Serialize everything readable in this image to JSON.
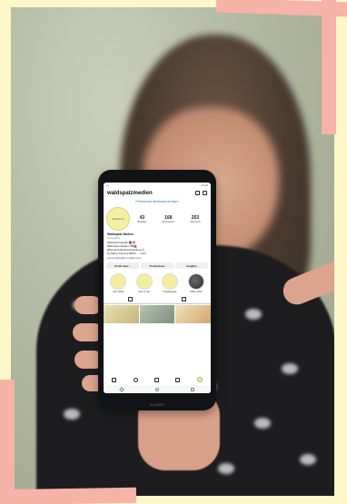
{
  "photo": {
    "description_colors": {
      "background": "#aeb59d",
      "shirt": "#1d1d1f",
      "frame": "#f6b3a8",
      "border": "#fdf7c9"
    }
  },
  "phone": {
    "brand": "HUAWEI",
    "status": {
      "left": "•••",
      "right": "14:10"
    },
    "instagram": {
      "username": "waldspatzmedien",
      "dashboard_link": "Professional dashboard anzeigen",
      "avatar_text": "Waldspatz",
      "stats": [
        {
          "number": "43",
          "label": "Beiträge"
        },
        {
          "number": "168",
          "label": "Abonnenten"
        },
        {
          "number": "253",
          "label": "Abonniert"
        }
      ],
      "bio": {
        "name": "Waldspatz Medien",
        "category": "Fotograf/in",
        "lines": [
          "#Werbefotografie 🎥💗",
          "#Werbeproduktion 🎞🎬",
          "#Personlichkeitsentwicklung 🐍",
          "by Marie-Therese Biebs ... mehr",
          "www.waldspatz-medien.com"
        ]
      },
      "buttons": [
        "Profil bear...",
        "Promotions",
        "Insights"
      ],
      "highlights": [
        {
          "label": "Über Waldi"
        },
        {
          "label": "Wer ist das"
        },
        {
          "label": "Projektangeb."
        },
        {
          "label": "Offline 2022"
        }
      ]
    }
  }
}
